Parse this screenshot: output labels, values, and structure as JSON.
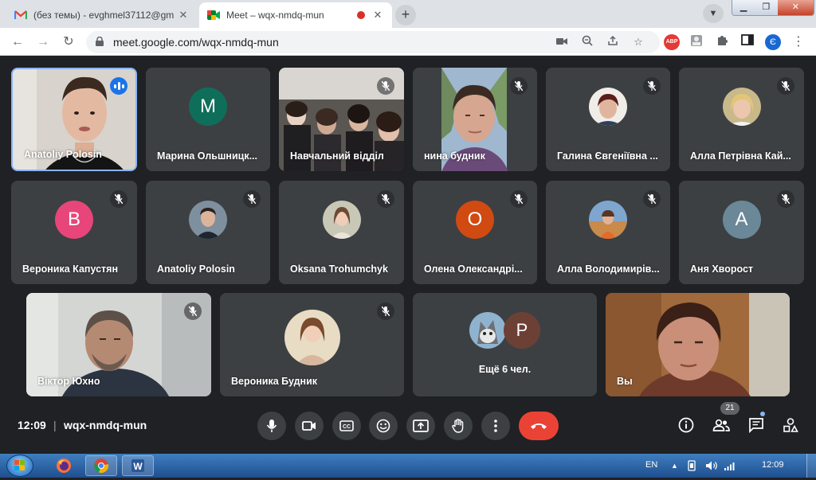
{
  "browser": {
    "tabs": [
      {
        "title": "(без темы) - evghmel37112@gm",
        "favicon": "gmail-icon",
        "active": false
      },
      {
        "title": "Meet – wqx-nmdq-mun",
        "favicon": "meet-icon",
        "active": true,
        "recording": true
      }
    ],
    "url": "meet.google.com/wqx-nmdq-mun",
    "profile_initial": "Є",
    "abp_label": "ABP"
  },
  "participants": [
    {
      "name": "Anatoliy Polosin",
      "type": "video",
      "speaking": true
    },
    {
      "name": "Марина Ольшницк...",
      "type": "initial",
      "initial": "M",
      "color": "#0f6e5a"
    },
    {
      "name": "Навчальний відділ",
      "type": "video",
      "muted": true
    },
    {
      "name": "нина будник",
      "type": "video",
      "muted": true
    },
    {
      "name": "Галина Євгеніївна ...",
      "type": "photo",
      "muted": true
    },
    {
      "name": "Алла Петрівна Кай...",
      "type": "photo",
      "muted": true
    },
    {
      "name": "Вероника Капустян",
      "type": "initial",
      "initial": "В",
      "color": "#e8457a",
      "muted": true
    },
    {
      "name": "Anatoliy Polosin",
      "type": "photo",
      "muted": true
    },
    {
      "name": "Oksana Trohumchyk",
      "type": "photo",
      "muted": true
    },
    {
      "name": "Олена Олександрі...",
      "type": "initial",
      "initial": "О",
      "color": "#d04a11",
      "muted": true
    },
    {
      "name": "Алла Володимирів...",
      "type": "photo",
      "muted": true
    },
    {
      "name": "Аня Хворост",
      "type": "initial",
      "initial": "А",
      "color": "#6a8898",
      "muted": true
    },
    {
      "name": "Віктор Юхно",
      "type": "video",
      "muted": true
    },
    {
      "name": "Вероника Будник",
      "type": "photo",
      "muted": true
    },
    {
      "name": "Ещё 6 чел.",
      "type": "overflow",
      "initial": "P",
      "color": "#6d4036"
    },
    {
      "name": "Вы",
      "type": "video"
    }
  ],
  "meeting": {
    "time": "12:09",
    "separator": "|",
    "code": "wqx-nmdq-mun",
    "participant_count": "21"
  },
  "taskbar": {
    "language": "EN",
    "clock": "12:09"
  }
}
